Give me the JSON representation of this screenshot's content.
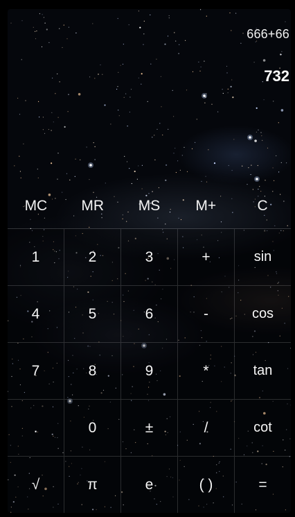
{
  "display": {
    "expression": "666+66",
    "result": "732"
  },
  "memory": [
    "MC",
    "MR",
    "MS",
    "M+",
    "C"
  ],
  "keypad": [
    [
      "1",
      "2",
      "3",
      "+",
      "sin"
    ],
    [
      "4",
      "5",
      "6",
      "-",
      "cos"
    ],
    [
      "7",
      "8",
      "9",
      "*",
      "tan"
    ],
    [
      ".",
      "0",
      "±",
      "/",
      "cot"
    ],
    [
      "√",
      "π",
      "e",
      "( )",
      "="
    ]
  ]
}
